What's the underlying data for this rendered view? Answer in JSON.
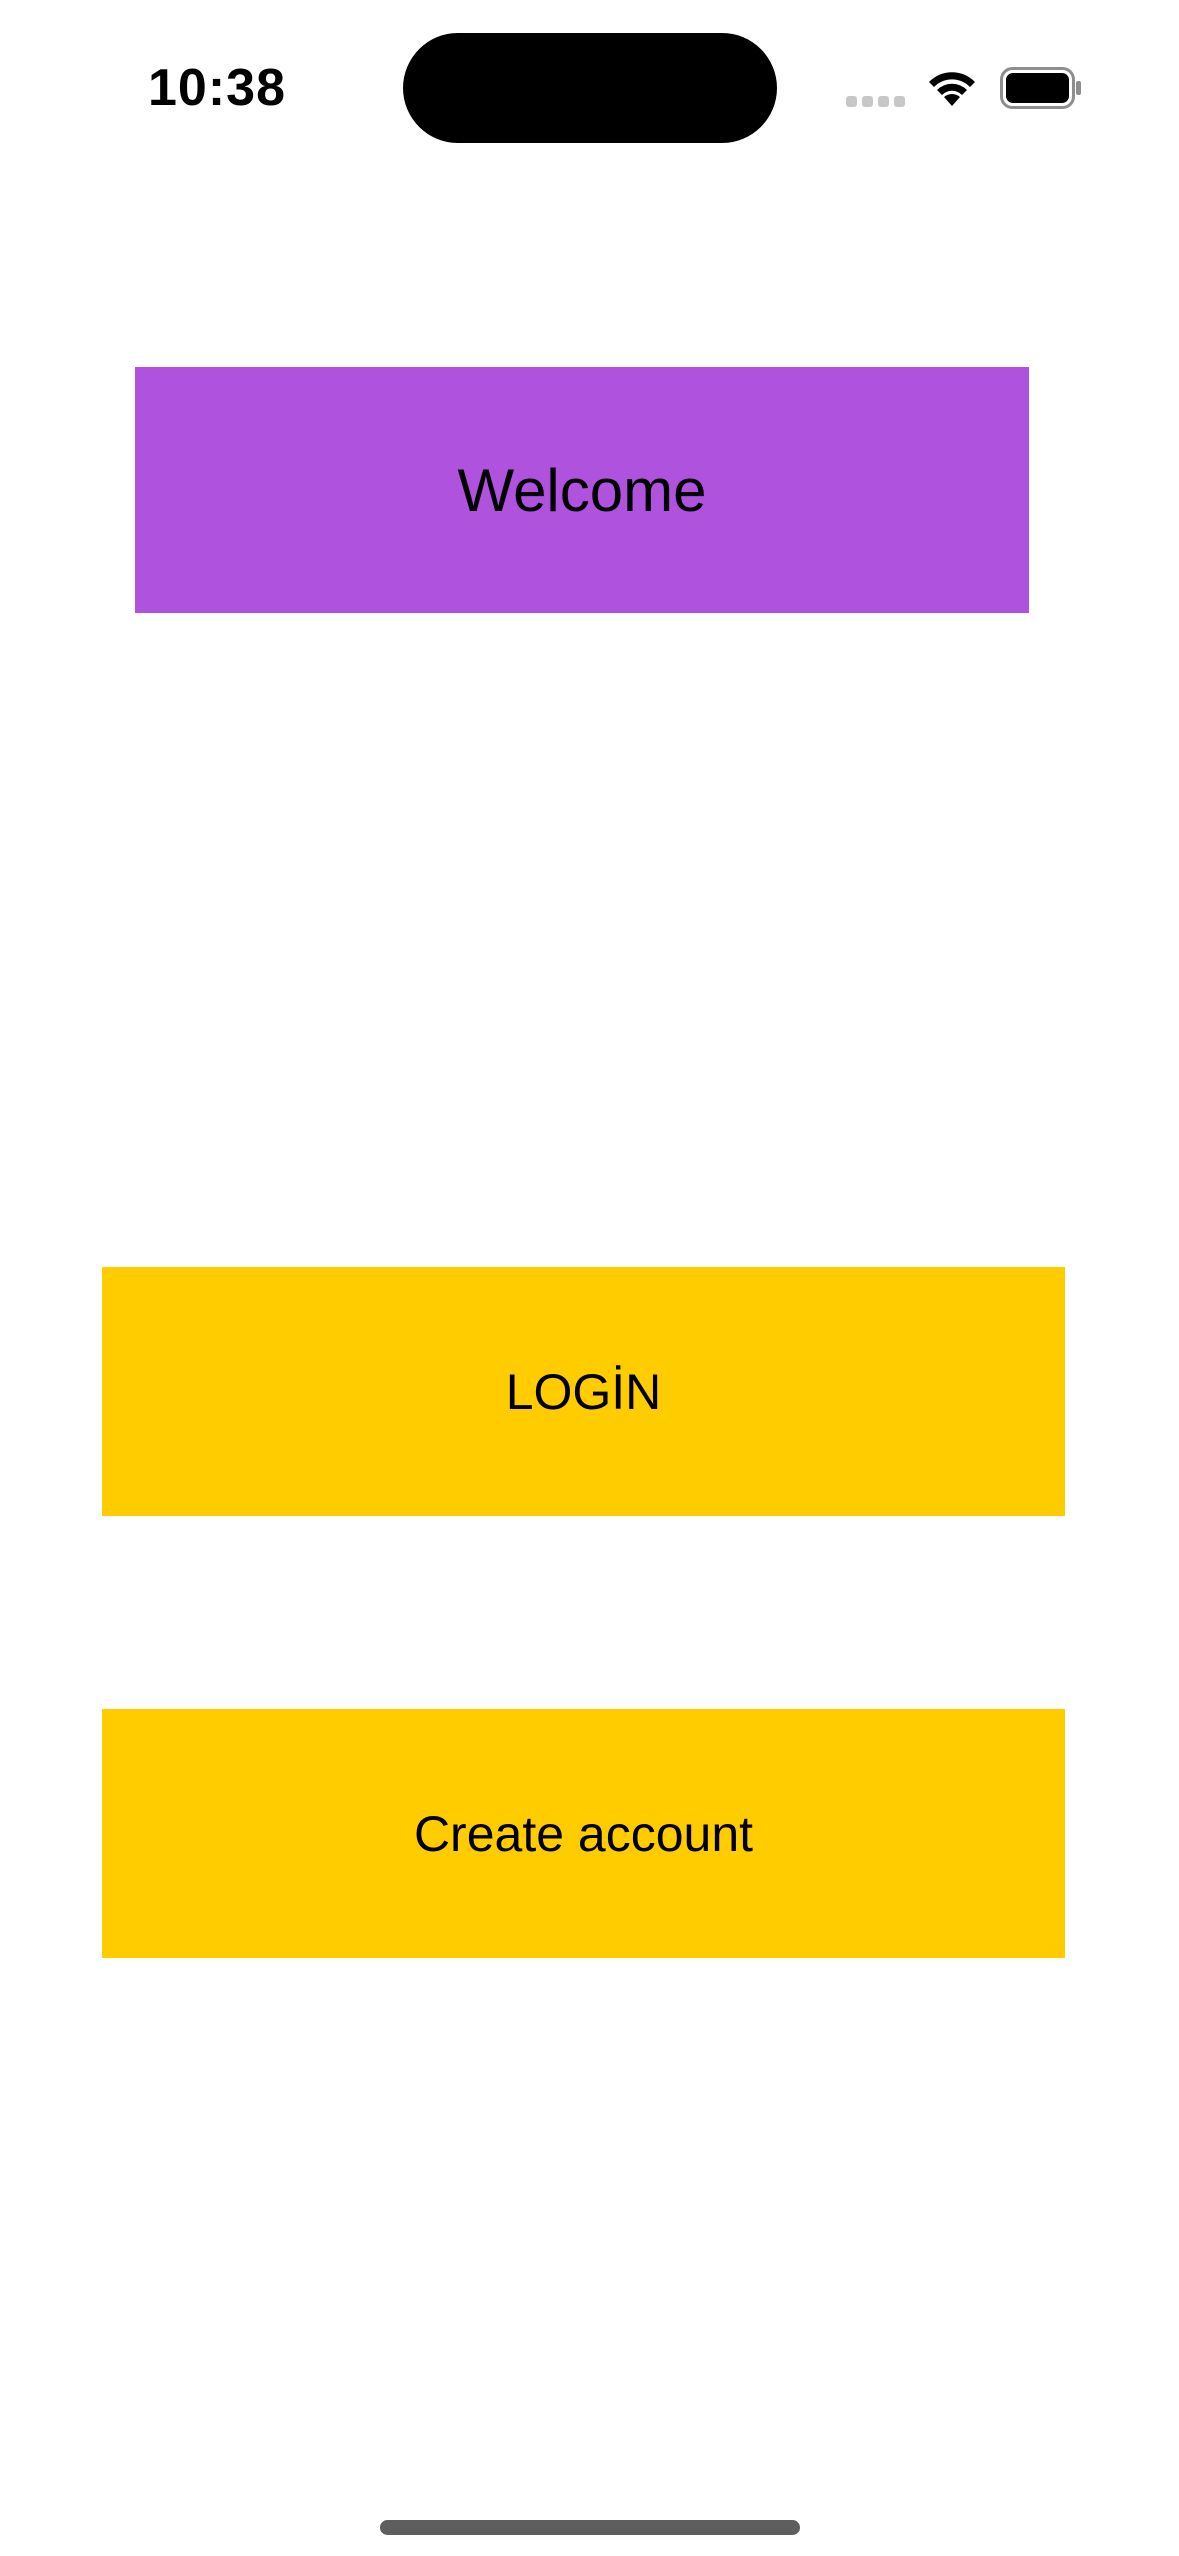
{
  "status_bar": {
    "time": "10:38",
    "icons": [
      "signal-dots-icon",
      "wifi-icon",
      "battery-icon"
    ]
  },
  "welcome": {
    "text": "Welcome",
    "background": "#af52de"
  },
  "buttons": {
    "login_label": "LOGİN",
    "create_account_label": "Create account",
    "background": "#ffcc00"
  }
}
